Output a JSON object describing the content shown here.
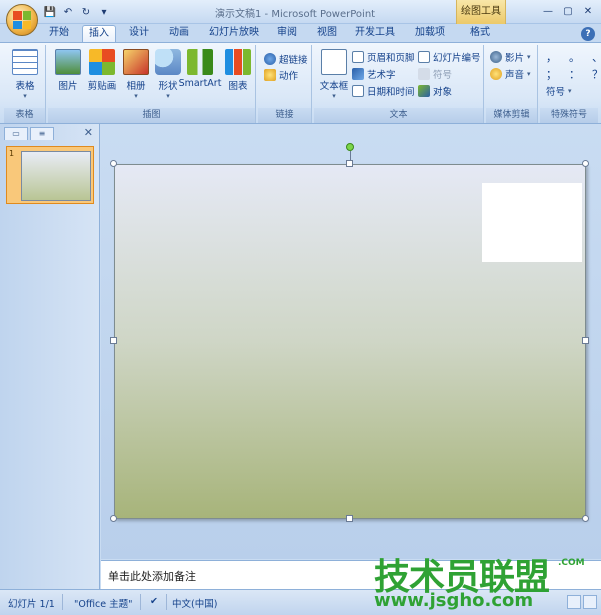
{
  "titlebar": {
    "title": "演示文稿1 - Microsoft PowerPoint",
    "context_tools": "绘图工具",
    "qat": {
      "save": "💾",
      "undo": "↶",
      "redo": "↻",
      "customize": "▾"
    },
    "controls": {
      "minimize": "—",
      "restore": "▢",
      "close": "✕"
    }
  },
  "tabs": [
    "开始",
    "插入",
    "设计",
    "动画",
    "幻灯片放映",
    "审阅",
    "视图",
    "开发工具",
    "加载项",
    "格式"
  ],
  "help": "?",
  "ribbon": {
    "groups": {
      "table": {
        "label": "表格",
        "button": "表格"
      },
      "illustrations": {
        "label": "插图",
        "buttons": [
          "图片",
          "剪贴画",
          "相册",
          "形状",
          "SmartArt",
          "图表"
        ]
      },
      "links": {
        "label": "链接",
        "items": [
          "超链接",
          "动作"
        ]
      },
      "text": {
        "label": "文本",
        "big": "文本框",
        "items": [
          "页眉和页脚",
          "艺术字",
          "日期和时间",
          "幻灯片编号",
          "符号",
          "对象"
        ]
      },
      "media": {
        "label": "媒体剪辑",
        "items": [
          "影片",
          "声音"
        ]
      },
      "special": {
        "label": "特殊符号",
        "chars": [
          "，",
          "。",
          "、",
          "；",
          "：",
          "？"
        ],
        "symbol_btn": "符号"
      }
    },
    "drop": "▾"
  },
  "leftpanel": {
    "tab1": "▭",
    "tab2": "≡",
    "close": "✕",
    "slide_number": "1"
  },
  "notes": {
    "placeholder": "单击此处添加备注"
  },
  "status": {
    "slide_info": "幻灯片 1/1",
    "theme": "\"Office 主题\"",
    "check": "✔",
    "language": "中文(中国)"
  },
  "watermark": {
    "main": "技术员联盟",
    "sub": "www.jsgho.com",
    "com": ".COM"
  },
  "colors": {
    "accent": "#15428b",
    "ribbon_bg": "#d9e7f7",
    "watermark": "#2fa234"
  }
}
